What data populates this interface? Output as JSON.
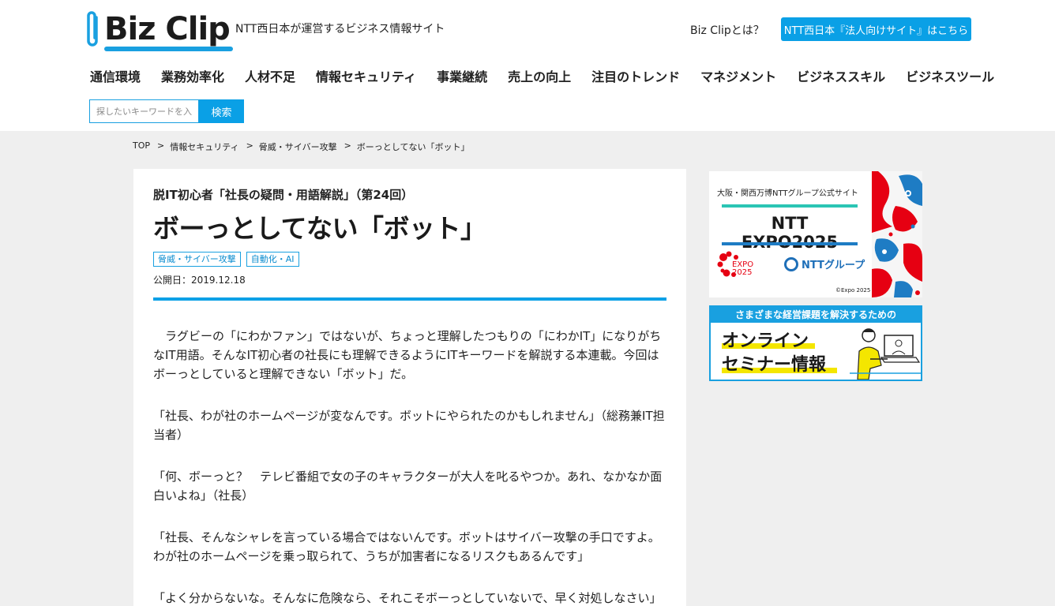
{
  "header": {
    "logo_text": "Biz Clip",
    "tagline": "NTT西日本が運営するビジネス情報サイト",
    "about_link": "Biz Clipとは？",
    "corp_button": "NTT西日本『法人向けサイト』はこちら"
  },
  "nav": {
    "items": [
      "通信環境",
      "業務効率化",
      "人材不足",
      "情報セキュリティ",
      "事業継続",
      "売上の向上",
      "注目のトレンド",
      "マネジメント",
      "ビジネススキル",
      "ビジネスツール"
    ]
  },
  "search": {
    "placeholder": "探したいキーワードを入力",
    "button": "検索"
  },
  "breadcrumb": {
    "sep": ">",
    "items": [
      "TOP",
      "情報セキュリティ",
      "脅威・サイバー攻撃",
      "ボーっとしてない「ボット」"
    ]
  },
  "article": {
    "series": "脱IT初心者「社長の疑問・用語解説」（第24回）",
    "title": "ボーっとしてない「ボット」",
    "tags": [
      "脅威・サイバー攻撃",
      "自動化・AI"
    ],
    "published": "公開日：2019.12.18",
    "paragraphs": [
      "　ラグビーの「にわかファン」ではないが、ちょっと理解したつもりの「にわかIT」になりがちなIT用語。そんなIT初心者の社長にも理解できるようにITキーワードを解説する本連載。今回はボーっとしていると理解できない「ボット」だ。",
      "「社長、わが社のホームページが変なんです。ボットにやられたのかもしれません」（総務兼IT担当者）",
      "「何、ボーっと？　テレビ番組で女の子のキャラクターが大人を叱るやつか。あれ、なかなか面白いよね」（社長）",
      "「社長、そんなシャレを言っている場合ではないんです。ボットはサイバー攻撃の手口ですよ。わが社のホームページを乗っ取られて、うちが加害者になるリスクもあるんです」",
      "「よく分からないな。そんなに危険なら、それこそボーっとしていないで、早く対処しなさい」"
    ]
  },
  "sidebar": {
    "expo": {
      "subtitle": "大阪・関西万博NTTグループ公式サイト",
      "title": "NTT EXPO2025",
      "mark_top": "EXPO",
      "mark_bottom": "2025",
      "group": "NTTグループ",
      "copyright": "©Expo 2025"
    },
    "seminar": {
      "header": "さまざまな経営課題を解決するための",
      "line1": "オンライン",
      "line2": "セミナー情報"
    }
  },
  "colors": {
    "accent": "#0aa0e6",
    "page_bg": "#efefef"
  }
}
